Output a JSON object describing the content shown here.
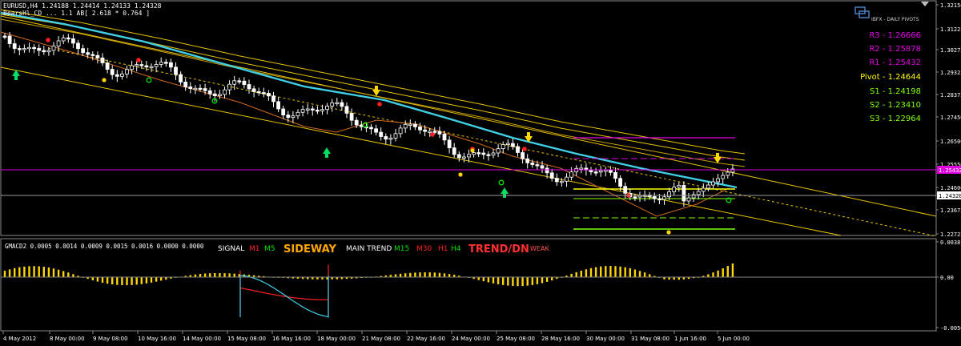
{
  "header": {
    "symbol_line": "EURUSD,H4  1.24188 1.24414 1.24133 1.24328",
    "indicator_line": "BearsHl_CD ... 1.1 AB[ 2.618 * 0.764 ]"
  },
  "price_axis": {
    "ticks": [
      "1.32150",
      "1.31225",
      "1.30275",
      "1.29325",
      "1.28375",
      "1.27450",
      "1.26500",
      "1.25550",
      "1.24600",
      "1.24328",
      "1.23675",
      "1.22725"
    ],
    "current_price": "1.24328",
    "marker_price": "1.25432"
  },
  "pivots_panel": {
    "logo_label": "IBFX - DAILY PIVOTS",
    "levels": [
      {
        "label": "R3 - 1.26666",
        "color": "#e000e0"
      },
      {
        "label": "R2 - 1.25878",
        "color": "#e000e0"
      },
      {
        "label": "R1 - 1.25432",
        "color": "#e000e0"
      },
      {
        "label": "Pivot - 1.24644",
        "color": "#ffff00"
      },
      {
        "label": "S1 - 1.24198",
        "color": "#7fff00"
      },
      {
        "label": "S2 - 1.23410",
        "color": "#7fff00"
      },
      {
        "label": "S3 - 1.22964",
        "color": "#7fff00"
      }
    ]
  },
  "sub_window": {
    "title": "GMACD2 0.0005 0.0014 0.0009 0.0015 0.0016 0.0000 0.0000",
    "signal_label": "SIGNAL",
    "signal_m1": "M1",
    "signal_m5": "M5",
    "signal_state": "SIDEWAY",
    "main_trend_label": "MAIN TREND",
    "trend_m15": "M15",
    "trend_m30": "M30",
    "trend_h1": "H1",
    "trend_h4": "H4",
    "trend_state": "TREND/DN",
    "trend_strength": "WEAK",
    "axis_ticks": [
      "0.0038",
      "0.00",
      "-0.0050"
    ]
  },
  "time_axis": {
    "labels": [
      "4 May 2012",
      "8 May 00:00",
      "9 May 08:00",
      "10 May 16:00",
      "14 May 00:00",
      "15 May 08:00",
      "16 May 16:00",
      "18 May 00:00",
      "21 May 08:00",
      "22 May 16:00",
      "24 May 00:00",
      "25 May 08:00",
      "28 May 16:00",
      "30 May 00:00",
      "31 May 08:00",
      "1 Jun 16:00",
      "5 Jun 00:00"
    ]
  },
  "colors": {
    "candle": "#ffffff",
    "ma_main": "#3fd0e8",
    "channel": "#e6c200",
    "macd_pos": "#ffd700",
    "macd_line1": "#ff2020",
    "macd_line2": "#3fd0e8",
    "pivot_r": "#e000e0",
    "pivot_s": "#7fff00",
    "pivot_p": "#ffff00"
  }
}
